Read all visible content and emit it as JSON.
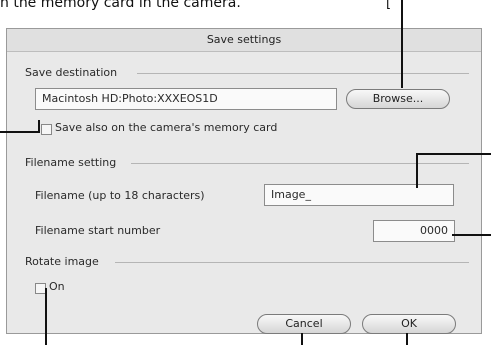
{
  "caption_left": "n the memory card in the camera.",
  "caption_right_fragment": "[",
  "dialog": {
    "title": "Save settings",
    "save_destination": {
      "title": "Save destination",
      "path_value": "Macintosh HD:Photo:XXXEOS1D",
      "browse_label": "Browse...",
      "also_save_label": "Save also on the camera's memory card",
      "also_save_checked": false
    },
    "filename_setting": {
      "title": "Filename setting",
      "filename_label": "Filename (up to 18 characters)",
      "filename_value": "Image_",
      "start_number_label": "Filename start number",
      "start_number_value": "0000"
    },
    "rotate_image": {
      "title": "Rotate image",
      "on_label": "On",
      "on_checked": false
    },
    "cancel_label": "Cancel",
    "ok_label": "OK"
  }
}
